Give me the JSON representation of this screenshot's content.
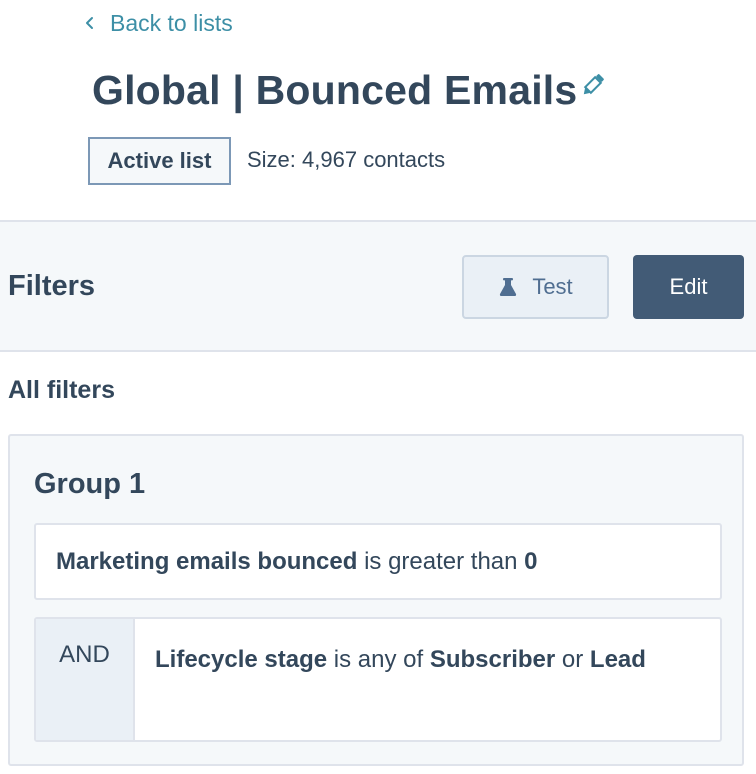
{
  "nav": {
    "back_label": "Back to lists"
  },
  "header": {
    "title": "Global | Bounced Emails",
    "status_badge": "Active list",
    "size_text": "Size: 4,967 contacts"
  },
  "filters_bar": {
    "heading": "Filters",
    "test_label": "Test",
    "edit_label": "Edit"
  },
  "filters": {
    "section_label": "All filters",
    "groups": [
      {
        "title": "Group 1",
        "rules": [
          {
            "property": "Marketing emails bounced",
            "operator": "is greater than",
            "value": "0"
          },
          {
            "connector": "AND",
            "property": "Lifecycle stage",
            "operator": "is any of",
            "value_1": "Subscriber",
            "joiner": "or",
            "value_2": "Lead"
          }
        ]
      }
    ]
  },
  "colors": {
    "text": "#33475b",
    "link": "#3d8fa6",
    "primary_button": "#425b76",
    "secondary_button": "#eaf0f6",
    "panel_bg": "#f5f8fa",
    "border": "#dfe3eb"
  },
  "icons": {
    "back": "chevron-left-icon",
    "edit_title": "pencil-icon",
    "test": "flask-icon"
  }
}
